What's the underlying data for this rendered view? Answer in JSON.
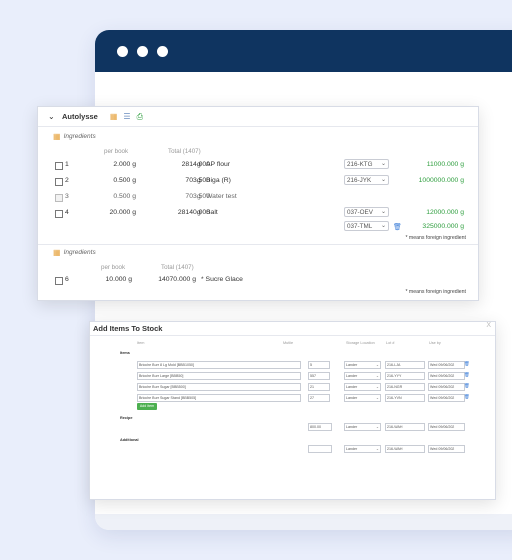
{
  "autolysse": {
    "title": "Autolysse",
    "section_label": "Ingredients",
    "col_per_book": "per book",
    "col_total": "Total (1407)",
    "rows": [
      {
        "num": "1",
        "per_book": "2.000 g",
        "total": "2814.000",
        "unit": "g",
        "name": "AP flour",
        "lot": "216-KTG",
        "amount": "11000.000 g"
      },
      {
        "num": "2",
        "per_book": "0.500 g",
        "total": "703.500",
        "unit": "g",
        "name": "Biga (R)",
        "lot": "216-JYK",
        "amount": "1000000.000 g"
      },
      {
        "num": "3",
        "per_book": "0.500 g",
        "total": "703.500",
        "unit": "g",
        "name": "Water test"
      },
      {
        "num": "4",
        "per_book": "20.000 g",
        "total": "28140.000",
        "unit": "g",
        "name": "Salt",
        "lot": "037-OEV",
        "amount": "12000.000 g",
        "lot2": "037-TML",
        "amount2": "325000.000 g"
      }
    ],
    "foreign_note": "* means foreign ingredient",
    "section2_label": "Ingredients",
    "col2_per_book": "per book",
    "col2_total": "Total (1407)",
    "row6": {
      "num": "6",
      "per_book": "10.000 g",
      "total": "14070.000 g",
      "name": "* Sucre Glace"
    },
    "foreign_note2": "* means foreign ingredient"
  },
  "stock_dialog": {
    "title": "Add Items To Stock",
    "close": "X",
    "col_item": "Item",
    "col_mutliple": "Mutlie",
    "col_storage": "Storage Location",
    "col_lot": "Lot #",
    "col_usedby": "Use by",
    "items_label": "Items",
    "items": [
      {
        "name": "Brioche Burr 8 Lg Mold [BBB1050]",
        "qty": "5",
        "storage": "Lander",
        "lot": "216-LJA",
        "date": "Wed 09/06/202"
      },
      {
        "name": "Brioche Burr Large [BBB50]",
        "qty": "557",
        "storage": "Lander",
        "lot": "216-YYY",
        "date": "Wed 09/06/202"
      },
      {
        "name": "Brioche Burr Sugar [BBB500]",
        "qty": "21",
        "storage": "Lander",
        "lot": "216-NGR",
        "date": "Wed 09/06/202"
      },
      {
        "name": "Brioche Burr Sugar Stand [BBB505]",
        "qty": "27",
        "storage": "Lander",
        "lot": "216-YVN",
        "date": "Wed 09/06/202"
      }
    ],
    "add_item": "Add item",
    "recipe_label": "Recipe",
    "recipe": {
      "qty": "800.00",
      "storage": "Lander",
      "lot": "216-WAH",
      "date": "Wed 09/06/202"
    },
    "additional_label": "Additional",
    "additional": {
      "qty": "",
      "storage": "Lander",
      "lot": "216-WAH",
      "date": "Wed 09/06/202"
    }
  }
}
